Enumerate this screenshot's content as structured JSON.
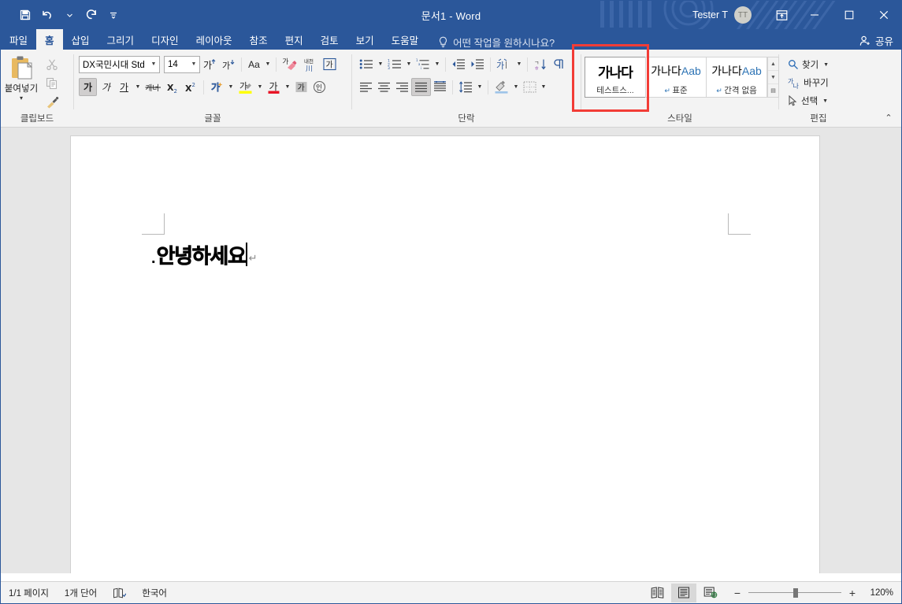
{
  "titlebar": {
    "document_title": "문서1  -  Word",
    "quick_access": [
      {
        "name": "save",
        "label": "저장"
      },
      {
        "name": "undo",
        "label": "실행 취소"
      },
      {
        "name": "redo",
        "label": "다시 실행"
      },
      {
        "name": "customize",
        "label": "빠른 실행 도구 모음 사용자 지정"
      }
    ],
    "user_name": "Tester T",
    "user_initials": "TT",
    "ribbon_display_options": "리본 표시 옵션",
    "minimize": "최소화",
    "maximize": "최대화",
    "close": "닫기"
  },
  "tabs": [
    {
      "label": "파일",
      "active": false
    },
    {
      "label": "홈",
      "active": true
    },
    {
      "label": "삽입",
      "active": false
    },
    {
      "label": "그리기",
      "active": false
    },
    {
      "label": "디자인",
      "active": false
    },
    {
      "label": "레이아웃",
      "active": false
    },
    {
      "label": "참조",
      "active": false
    },
    {
      "label": "편지",
      "active": false
    },
    {
      "label": "검토",
      "active": false
    },
    {
      "label": "보기",
      "active": false
    },
    {
      "label": "도움말",
      "active": false
    }
  ],
  "tell_me": {
    "placeholder": "어떤 작업을 원하시나요?"
  },
  "share": {
    "label": "공유"
  },
  "ribbon": {
    "clipboard": {
      "group_label": "클립보드",
      "paste_label": "붙여넣기",
      "cut_label": "잘라내기",
      "copy_label": "복사",
      "format_painter_label": "서식 복사"
    },
    "font": {
      "group_label": "글꼴",
      "font_name": "DX국민시대 Std",
      "font_size": "14",
      "grow_font": "글꼴 크게",
      "shrink_font": "글꼴 작게",
      "change_case": "Aa",
      "change_case_label": "대/소문자 바꾸기",
      "clear_formatting": "서식 지우기",
      "phonetic_guide": "윗주 달기",
      "phonetic_glyph": "내천川",
      "char_border": "가",
      "char_border_label": "문자 테두리",
      "bold": "가",
      "italic": "가",
      "underline": "가",
      "strikethrough": "개너",
      "subscript": "X₂",
      "superscript": "X²",
      "text_effects": "가",
      "text_effects_label": "텍스트 효과와 타이포그래피",
      "highlight": "가",
      "highlight_label": "텍스트 강조 색",
      "font_color": "가",
      "font_color_label": "글꼴 색",
      "char_shading": "가",
      "char_shading_label": "문자 음영",
      "enclose_char": "인",
      "enclose_char_label": "원 문자"
    },
    "paragraph": {
      "group_label": "단락",
      "bullets": "글머리 기호",
      "numbering": "번호 매기기",
      "multilevel": "다단계 목록",
      "decrease_indent": "들여쓰기 줄임",
      "increase_indent": "들여쓰기 늘림",
      "asian_layout": "한글/한자 변환",
      "sort": "정렬",
      "show_marks": "편집 기호 표시/숨기기",
      "align_left": "왼쪽 맞춤",
      "align_center": "가운데 맞춤",
      "align_right": "오른쪽 맞춤",
      "justify": "양쪽 맞춤",
      "distribute": "균등 분할",
      "line_spacing": "줄 간격",
      "shading": "음영",
      "borders": "테두리"
    },
    "styles": {
      "group_label": "스타일",
      "items": [
        {
          "preview": "가나다",
          "name": "테스트스...",
          "selected": true,
          "pilcrow": false
        },
        {
          "preview_ko": "가나다",
          "preview_en": "Aab",
          "name": "표준",
          "selected": false,
          "pilcrow": true
        },
        {
          "preview_ko": "가나다",
          "preview_en": "Aab",
          "name": "간격 없음",
          "selected": false,
          "pilcrow": true
        }
      ],
      "scroll_up": "위로",
      "scroll_down": "아래로",
      "scroll_more": "기타"
    },
    "editing": {
      "group_label": "편집",
      "find": "찾기",
      "replace": "바꾸기",
      "select": "선택"
    },
    "collapse_ribbon": "리본 메뉴 축소"
  },
  "document": {
    "bullet": ".",
    "text": "안녕하세요",
    "paragraph_mark": "↵"
  },
  "statusbar": {
    "page": "1/1 페이지",
    "words": "1개 단어",
    "proofing": "맞춤법 및 문법 검사",
    "language": "한국어",
    "views": [
      {
        "name": "read-mode",
        "label": "읽기 모드",
        "active": false
      },
      {
        "name": "print-layout",
        "label": "인쇄 모양",
        "active": true
      },
      {
        "name": "web-layout",
        "label": "웹 모양",
        "active": false
      }
    ],
    "zoom_out": "−",
    "zoom_in": "+",
    "zoom_level": "120%"
  },
  "colors": {
    "word_blue": "#2b579a",
    "ribbon_bg": "#f3f3f3",
    "highlight_red": "#f23c36",
    "doc_gray": "#e6e6e6"
  }
}
